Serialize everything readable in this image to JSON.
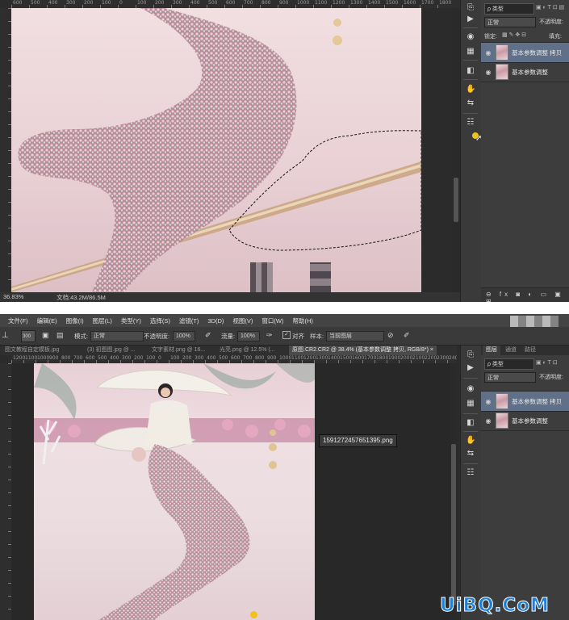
{
  "top_window": {
    "ruler_ticks": [
      "600",
      "500",
      "400",
      "300",
      "200",
      "100",
      "0",
      "100",
      "200",
      "300",
      "400",
      "500",
      "600",
      "700",
      "800",
      "900",
      "1000",
      "1100",
      "1200",
      "1300",
      "1400",
      "1500",
      "1600",
      "1700",
      "1800"
    ],
    "zoom": "36.83%",
    "doc_info": "文档:43.2M/86.5M",
    "layers_panel": {
      "filter_label": "ρ 类型",
      "blend_mode": "正常",
      "opacity_label": "不透明度:",
      "lock_label": "锁定:",
      "fill_label": "填充:",
      "layers": [
        {
          "name": "基本参数调整 拷贝",
          "selected": true
        },
        {
          "name": "基本参数调整",
          "selected": false
        }
      ]
    }
  },
  "bottom_window": {
    "menu": [
      "文件(F)",
      "编辑(E)",
      "图像(I)",
      "图层(L)",
      "类型(Y)",
      "选择(S)",
      "滤镜(T)",
      "3D(D)",
      "视图(V)",
      "窗口(W)",
      "帮助(H)"
    ],
    "options_bar": {
      "brush_size": "300",
      "mode_label": "模式:",
      "mode_value": "正常",
      "opacity_label": "不透明度:",
      "opacity_value": "100%",
      "flow_label": "流量:",
      "flow_value": "100%",
      "align_label": "对齐",
      "sample_label": "样本:",
      "sample_value": "当前图层"
    },
    "doc_tabs": [
      "图文教程自定模板.jpg",
      "(3) 初图图.jpg @ ...",
      "文字素材.png @ 16...",
      "光亮.png @ 12.5% (...",
      "原图.CR2.CR2 @ 38.4% (基本参数调整 拷贝, RGB/8*) ×"
    ],
    "ruler_ticks": [
      "1200",
      "1100",
      "1000",
      "900",
      "800",
      "700",
      "600",
      "500",
      "400",
      "300",
      "200",
      "100",
      "0",
      "100",
      "200",
      "300",
      "400",
      "500",
      "600",
      "700",
      "800",
      "900",
      "1000",
      "1100",
      "1200",
      "1300",
      "1400",
      "1500",
      "1600",
      "1700",
      "1800",
      "1900",
      "2000",
      "2100",
      "2200",
      "2300",
      "2400"
    ],
    "file_tooltip": "1591272457651395.png",
    "layers_panel": {
      "tabs": [
        "图层",
        "通道",
        "路径"
      ],
      "filter_label": "ρ 类型",
      "blend_mode": "正常",
      "opacity_label": "不透明度:",
      "layers": [
        {
          "name": "基本参数调整 拷贝",
          "selected": true
        },
        {
          "name": "基本参数调整",
          "selected": false
        }
      ]
    }
  },
  "watermark": "UiBQ.CoM",
  "colors": {
    "ps_bg": "#3a3a3a",
    "ps_dark": "#282828",
    "selection": "#5f7088",
    "canvas_pink": "#e8cfd2",
    "watermark": "#1f7fd6"
  }
}
